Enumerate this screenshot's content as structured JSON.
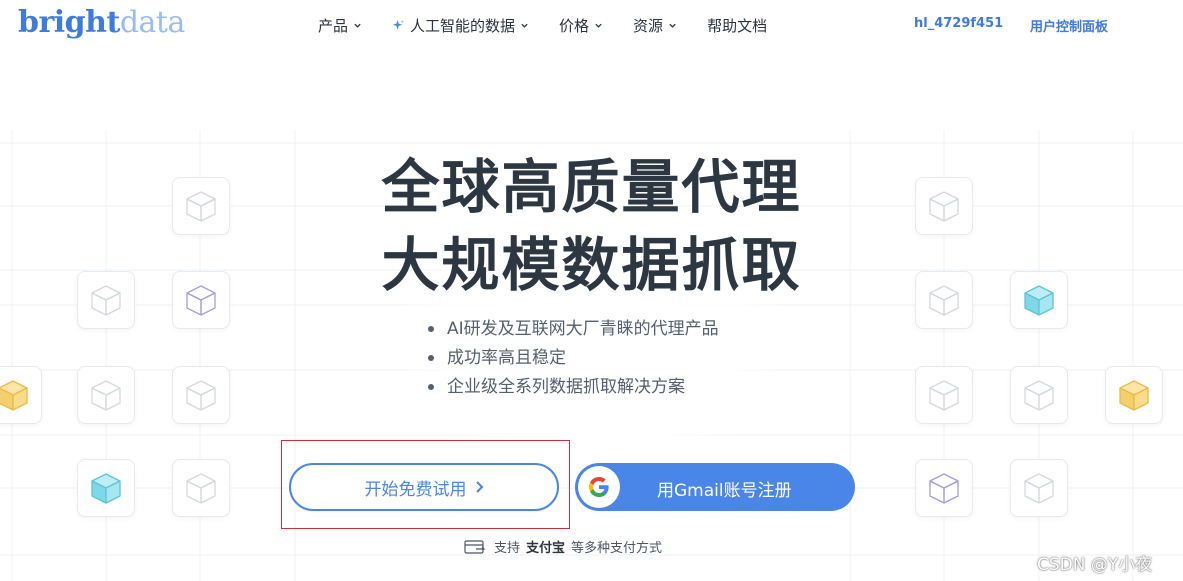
{
  "header": {
    "logo_primary": "bright",
    "logo_secondary": "data",
    "nav": [
      {
        "label": "产品",
        "has_dropdown": true
      },
      {
        "label": "人工智能的数据",
        "has_dropdown": true,
        "icon": "sparkle-icon"
      },
      {
        "label": "价格",
        "has_dropdown": true
      },
      {
        "label": "资源",
        "has_dropdown": true
      },
      {
        "label": "帮助文档",
        "has_dropdown": false
      }
    ],
    "account": "hl_4729f451",
    "dashboard": "用户控制面板"
  },
  "hero": {
    "title_line1": "全球高质量代理",
    "title_line2": "大规模数据抓取",
    "bullets": [
      "AI研发及互联网大厂青睐的代理产品",
      "成功率高且稳定",
      "企业级全系列数据抓取解决方案"
    ],
    "trial_button": "开始免费试用",
    "gmail_button": "用Gmail账号注册",
    "payment_prefix": "支持",
    "payment_brand": "支付宝",
    "payment_suffix": "等多种支付方式"
  },
  "watermark": "CSDN @Y小夜",
  "colors": {
    "brand_blue": "#4a86e8",
    "logo_blue": "#3d7be0",
    "logo_light": "#9bbcf0",
    "title_text": "#2d3742",
    "highlight_border": "#c8303a",
    "cube_gray": "#d5d9df",
    "cube_purple": "#a99be8",
    "cube_cyan": "#7fd8e8",
    "cube_yellow": "#f5cf6b"
  }
}
